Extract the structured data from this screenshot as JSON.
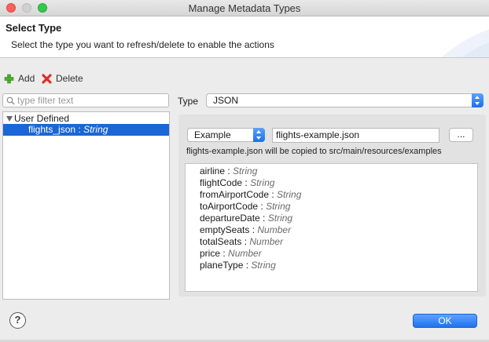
{
  "window": {
    "title": "Manage Metadata Types"
  },
  "header": {
    "title": "Select Type",
    "description": "Select the type you want to refresh/delete to enable the actions"
  },
  "toolbar": {
    "add_label": "Add",
    "delete_label": "Delete"
  },
  "filter": {
    "placeholder": "type filter text"
  },
  "tree": {
    "group": "User Defined",
    "selected_item": "flights_json",
    "selected_type": "String"
  },
  "type_selector": {
    "label": "Type",
    "value": "JSON"
  },
  "source": {
    "mode": "Example",
    "file": "flights-example.json",
    "browse_label": "...",
    "note": "flights-example.json will be copied to src/main/resources/examples"
  },
  "schema_fields": [
    {
      "name": "airline",
      "type": "String"
    },
    {
      "name": "flightCode",
      "type": "String"
    },
    {
      "name": "fromAirportCode",
      "type": "String"
    },
    {
      "name": "toAirportCode",
      "type": "String"
    },
    {
      "name": "departureDate",
      "type": "String"
    },
    {
      "name": "emptySeats",
      "type": "Number"
    },
    {
      "name": "totalSeats",
      "type": "Number"
    },
    {
      "name": "price",
      "type": "Number"
    },
    {
      "name": "planeType",
      "type": "String"
    }
  ],
  "footer": {
    "help_label": "?",
    "ok_label": "OK"
  },
  "colors": {
    "accent": "#1a66d6",
    "selection": "#1a66d6",
    "add": "#4caf2a",
    "delete": "#d9312b"
  }
}
